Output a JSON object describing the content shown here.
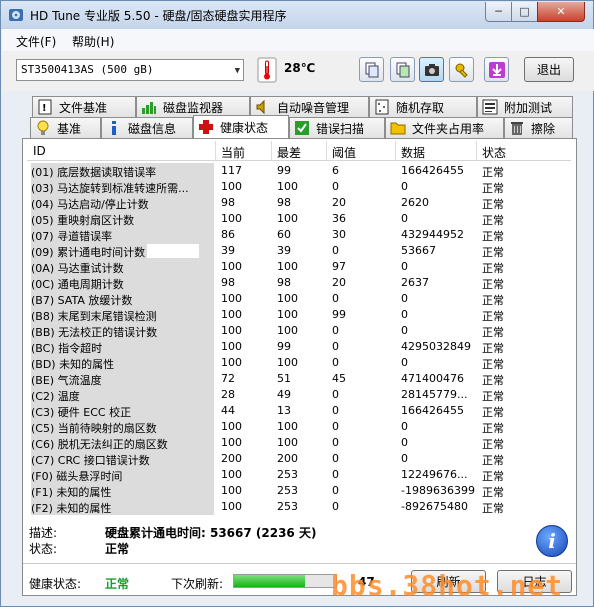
{
  "window": {
    "title": "HD Tune 专业版 5.50 - 硬盘/固态硬盘实用程序",
    "minimize": "─",
    "maximize": "□",
    "close": "✕"
  },
  "menu": {
    "file": "文件(F)",
    "help": "帮助(H)"
  },
  "toolbar": {
    "drive": "ST3500413AS  (500 gB)",
    "temperature": "28℃",
    "exit_label": "退出",
    "icons": [
      "copy-info-icon",
      "copy-screenshot-icon",
      "camera-icon",
      "settings-icon",
      "save-icon"
    ]
  },
  "tabs_top": [
    {
      "label": "文件基准",
      "icon": "file-benchmark-icon"
    },
    {
      "label": "磁盘监视器",
      "icon": "disk-monitor-icon"
    },
    {
      "label": "自动噪音管理",
      "icon": "speaker-icon"
    },
    {
      "label": "随机存取",
      "icon": "random-access-icon"
    },
    {
      "label": "附加测试",
      "icon": "extra-tests-icon"
    }
  ],
  "tabs_bottom": [
    {
      "label": "基准",
      "icon": "bulb-icon"
    },
    {
      "label": "磁盘信息",
      "icon": "info-icon"
    },
    {
      "label": "健康状态",
      "icon": "health-cross-icon"
    },
    {
      "label": "错误扫描",
      "icon": "scan-icon"
    },
    {
      "label": "文件夹占用率",
      "icon": "folder-icon"
    },
    {
      "label": "擦除",
      "icon": "trash-icon"
    }
  ],
  "table": {
    "headers": [
      "ID",
      "当前",
      "最差",
      "阈值",
      "数据",
      "状态"
    ],
    "rows": [
      {
        "id": "(01) 底层数据读取错误率",
        "cur": "117",
        "worst": "99",
        "thr": "6",
        "data": "166426455",
        "status": "正常"
      },
      {
        "id": "(03) 马达旋转到标准转速所需...",
        "cur": "100",
        "worst": "100",
        "thr": "0",
        "data": "0",
        "status": "正常"
      },
      {
        "id": "(04) 马达启动/停止计数",
        "cur": "98",
        "worst": "98",
        "thr": "20",
        "data": "2620",
        "status": "正常"
      },
      {
        "id": "(05) 重映射扇区计数",
        "cur": "100",
        "worst": "100",
        "thr": "36",
        "data": "0",
        "status": "正常"
      },
      {
        "id": "(07) 寻道错误率",
        "cur": "86",
        "worst": "60",
        "thr": "30",
        "data": "432944952",
        "status": "正常"
      },
      {
        "id": "(09) 累计通电时间计数",
        "cur": "39",
        "worst": "39",
        "thr": "0",
        "data": "53667",
        "status": "正常"
      },
      {
        "id": "(0A) 马达重试计数",
        "cur": "100",
        "worst": "100",
        "thr": "97",
        "data": "0",
        "status": "正常"
      },
      {
        "id": "(0C) 通电周期计数",
        "cur": "98",
        "worst": "98",
        "thr": "20",
        "data": "2637",
        "status": "正常"
      },
      {
        "id": "(B7) SATA 放缓计数",
        "cur": "100",
        "worst": "100",
        "thr": "0",
        "data": "0",
        "status": "正常"
      },
      {
        "id": "(B8) 末尾到末尾错误检测",
        "cur": "100",
        "worst": "100",
        "thr": "99",
        "data": "0",
        "status": "正常"
      },
      {
        "id": "(BB) 无法校正的错误计数",
        "cur": "100",
        "worst": "100",
        "thr": "0",
        "data": "0",
        "status": "正常"
      },
      {
        "id": "(BC) 指令超时",
        "cur": "100",
        "worst": "99",
        "thr": "0",
        "data": "4295032849",
        "status": "正常"
      },
      {
        "id": "(BD) 未知的属性",
        "cur": "100",
        "worst": "100",
        "thr": "0",
        "data": "0",
        "status": "正常"
      },
      {
        "id": "(BE) 气流温度",
        "cur": "72",
        "worst": "51",
        "thr": "45",
        "data": "471400476",
        "status": "正常"
      },
      {
        "id": "(C2) 温度",
        "cur": "28",
        "worst": "49",
        "thr": "0",
        "data": "28145779...",
        "status": "正常"
      },
      {
        "id": "(C3) 硬件 ECC 校正",
        "cur": "44",
        "worst": "13",
        "thr": "0",
        "data": "166426455",
        "status": "正常"
      },
      {
        "id": "(C5) 当前待映射的扇区数",
        "cur": "100",
        "worst": "100",
        "thr": "0",
        "data": "0",
        "status": "正常"
      },
      {
        "id": "(C6) 脱机无法纠正的扇区数",
        "cur": "100",
        "worst": "100",
        "thr": "0",
        "data": "0",
        "status": "正常"
      },
      {
        "id": "(C7) CRC 接口错误计数",
        "cur": "200",
        "worst": "200",
        "thr": "0",
        "data": "0",
        "status": "正常"
      },
      {
        "id": "(F0) 磁头悬浮时间",
        "cur": "100",
        "worst": "253",
        "thr": "0",
        "data": "12249676...",
        "status": "正常"
      },
      {
        "id": "(F1) 未知的属性",
        "cur": "100",
        "worst": "253",
        "thr": "0",
        "data": "-1989636399",
        "status": "正常"
      },
      {
        "id": "(F2) 未知的属性",
        "cur": "100",
        "worst": "253",
        "thr": "0",
        "data": "-892675480",
        "status": "正常"
      }
    ]
  },
  "details": {
    "desc_label": "描述:",
    "desc_value": "硬盘累计通电时间: 53667  (2236 天)",
    "state_label": "状态:",
    "state_value": "正常"
  },
  "footer": {
    "health_label": "健康状态:",
    "health_value": "正常",
    "refresh_label": "下次刷新:",
    "refresh_progress": 0.7,
    "refresh_count": "47",
    "refresh_button": "刷新",
    "log_button": "日志",
    "watermark": "bbs.38hot.net"
  },
  "colors": {
    "ok_green": "#1a9c2e",
    "watermark": "#ff8c28"
  }
}
